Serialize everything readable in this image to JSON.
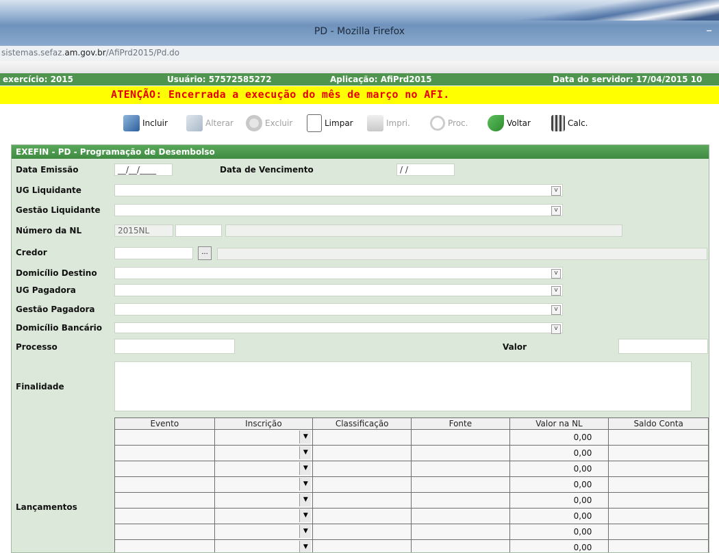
{
  "window": {
    "title": "PD - Mozilla Firefox",
    "minimize": "–"
  },
  "urlbar": {
    "prefix": "sistemas.sefaz.",
    "domain": "am.gov.br",
    "path": "/AfiPrd2015/Pd.do"
  },
  "infobar": {
    "exercicio": "exercício: 2015",
    "usuario": "Usuário: 57572585272",
    "aplicacao": "Aplicação: AfiPrd2015",
    "data_servidor": "Data do servidor: 17/04/2015 10"
  },
  "alert": "ATENÇÃO: Encerrada a execução do mês de março no AFI.",
  "toolbar": {
    "incluir": "Incluir",
    "alterar": "Alterar",
    "excluir": "Excluir",
    "limpar": "Limpar",
    "impri": "Impri.",
    "proc": "Proc.",
    "voltar": "Voltar",
    "calc": "Calc."
  },
  "panel": {
    "title": "EXEFIN - PD - Programação de Desembolso"
  },
  "form": {
    "data_emissao": {
      "label": "Data Emissão",
      "value": "__/__/____"
    },
    "data_vencimento": {
      "label": "Data de Vencimento",
      "value": " / /"
    },
    "ug_liquidante": "UG Liquidante",
    "gestao_liquidante": "Gestão Liquidante",
    "numero_nl": {
      "label": "Número da NL",
      "value": "2015NL"
    },
    "credor": {
      "label": "Credor",
      "button": "..."
    },
    "domicilio_destino": "Domicílio Destino",
    "ug_pagadora": "UG Pagadora",
    "gestao_pagadora": "Gestão Pagadora",
    "domicilio_bancario": "Domicílio Bancário",
    "processo": "Processo",
    "valor": "Valor",
    "finalidade": "Finalidade",
    "lancamentos": "Lançamentos"
  },
  "grid": {
    "headers": [
      "Evento",
      "Inscrição",
      "Classificação",
      "Fonte",
      "Valor na NL",
      "Saldo Conta"
    ],
    "rows": [
      "0,00",
      "0,00",
      "0,00",
      "0,00",
      "0,00",
      "0,00",
      "0,00",
      "0,00"
    ]
  }
}
